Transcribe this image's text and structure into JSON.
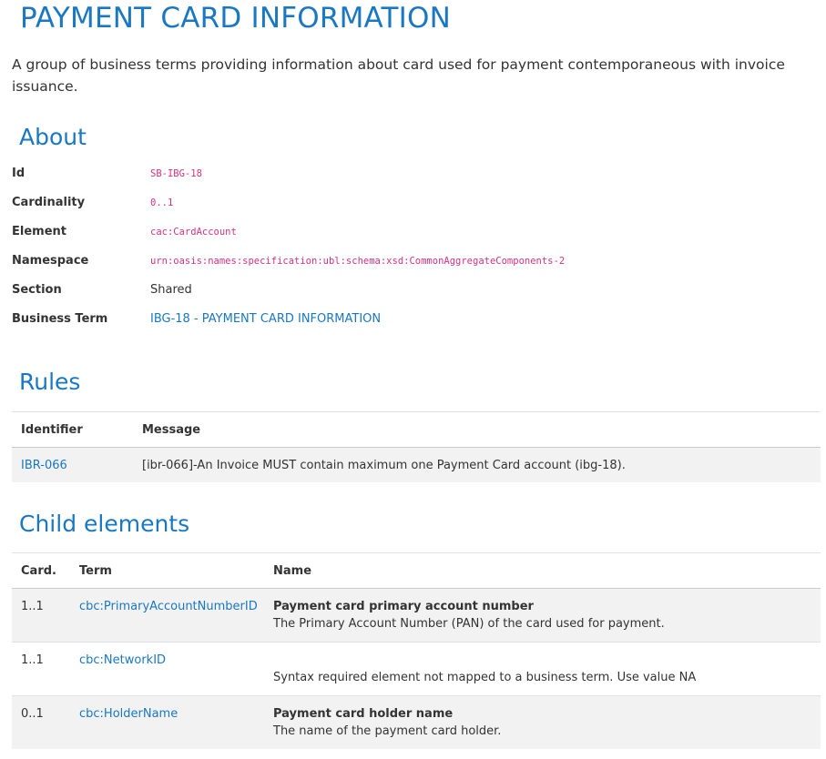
{
  "header": {
    "title": "PAYMENT CARD INFORMATION",
    "description": "A group of business terms providing information about card used for payment contemporaneous with invoice issuance."
  },
  "about": {
    "heading": "About",
    "rows": [
      {
        "label": "Id",
        "value": "SB-IBG-18"
      },
      {
        "label": "Cardinality",
        "value": "0..1"
      },
      {
        "label": "Element",
        "value": "cac:CardAccount"
      },
      {
        "label": "Namespace",
        "value": "urn:oasis:names:specification:ubl:schema:xsd:CommonAggregateComponents-2"
      },
      {
        "label": "Section",
        "value": "Shared"
      },
      {
        "label": "Business Term",
        "value": "IBG-18 - PAYMENT CARD INFORMATION"
      }
    ]
  },
  "rules": {
    "heading": "Rules",
    "columns": [
      "Identifier",
      "Message"
    ],
    "rows": [
      {
        "identifier": "IBR-066",
        "message": "[ibr-066]-An Invoice MUST contain maximum one Payment Card account (ibg-18)."
      }
    ]
  },
  "children": {
    "heading": "Child elements",
    "columns": [
      "Card.",
      "Term",
      "Name"
    ],
    "rows": [
      {
        "card": "1..1",
        "term": "cbc:PrimaryAccountNumberID",
        "name": "Payment card primary account number",
        "description": "The Primary Account Number (PAN) of the card used for payment."
      },
      {
        "card": "1..1",
        "term": "cbc:NetworkID",
        "name": "",
        "description": "Syntax required element not mapped to a business term. Use value NA"
      },
      {
        "card": "0..1",
        "term": "cbc:HolderName",
        "name": "Payment card holder name",
        "description": "The name of the payment card holder."
      }
    ]
  },
  "colors": {
    "accent": "#1a78c2",
    "code": "#d63384",
    "stripe": "#f2f2f2"
  }
}
